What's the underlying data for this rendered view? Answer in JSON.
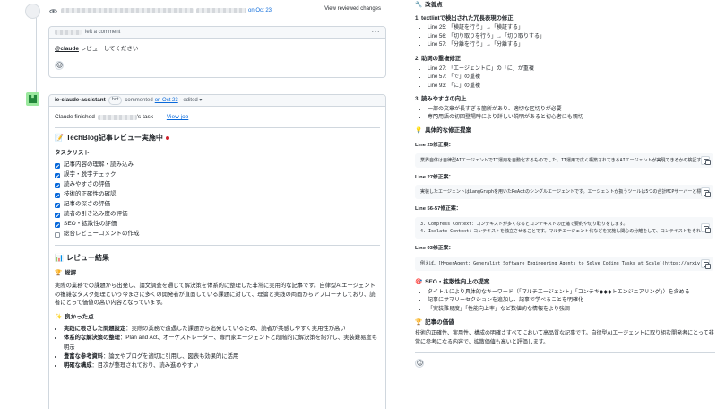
{
  "left": {
    "review_event": {
      "date_link": "on Oct 23",
      "view_reviewed": "View reviewed changes"
    },
    "comment1": {
      "header_action": "left a comment",
      "mention": "@claude",
      "body": " レビューしてください",
      "menu": "···"
    },
    "comment2": {
      "author": "ie-claude-assistant",
      "badge": "bot",
      "commented": "commented",
      "date_link": "on Oct 23",
      "edited": "· edited ▾",
      "menu": "···",
      "finished_prefix": "Claude finished",
      "finished_task": "'s task —— ",
      "view_job": "View job",
      "title": "TechBlog記事レビュー実施中",
      "title_icon": "memo-emoji",
      "task_heading": "タスクリスト",
      "tasks": [
        {
          "label": "記事内容の理解・読み込み",
          "done": true
        },
        {
          "label": "誤字・脱字チェック",
          "done": true
        },
        {
          "label": "読みやすさの評価",
          "done": true
        },
        {
          "label": "技術的正確性の確認",
          "done": true
        },
        {
          "label": "記事の深さの評価",
          "done": true
        },
        {
          "label": "読者の引き込み度の評価",
          "done": true
        },
        {
          "label": "SEO・拡散性の評価",
          "done": true
        },
        {
          "label": "総合レビューコメントの作成",
          "done": false
        }
      ],
      "review_title": "レビュー結果",
      "review_icon": "bar-chart-emoji",
      "overview_title": "総評",
      "overview_icon": "trophy-emoji",
      "overview": "実際の業務での課題から出発し、論文調査を通じて解決策を体系的に整理した非常に実用的な記事です。自律型AIエージェントの複雑なタスク処理という今まさに多くの開発者が直面している課題に対して、理論と実践の両面からアプローチしており、読者にとって価値の高い内容となっています。",
      "good_title": "良かった点",
      "good_icon": "sparkle-emoji",
      "good_points": [
        {
          "bold": "実践に根ざした問題設定",
          "text": "：実際の業務で遭遇した課題から出発しているため、読者が共感しやすく実用性が高い"
        },
        {
          "bold": "体系的な解決策の整理",
          "text": "：Plan and Act、オーケストレーター、専門家エージェントと段階的に解決策を紹介し、実装難易度も明示"
        },
        {
          "bold": "豊富な参考資料",
          "text": "：論文やブログを適切に引用し、図表も効果的に活用"
        },
        {
          "bold": "明確な構成",
          "text": "：目次が整理されており、読み進めやすい"
        }
      ]
    }
  },
  "right": {
    "improve_title": "改善点",
    "improve_icon": "wrench-emoji",
    "sec1": "1. textlintで検出された冗長表現の修正",
    "sec1_items": [
      "Line 25: 「検証を行う」→「検証する」",
      "Line 56: 「切り取りを行う」→「切り取りする」",
      "Line 57: 「分離を行う」→「分離する」"
    ],
    "sec2": "2. 助詞の重複修正",
    "sec2_items": [
      "Line 27: 「エージェントに」の「に」が重複",
      "Line 57: 「で」の重複",
      "Line 93: 「に」の重複"
    ],
    "sec3": "3. 読みやすさの向上",
    "sec3_items": [
      "一部の文章が長すぎる箇所があり、適切な区切りが必要",
      "専門用語の初回登場時により詳しい説明があると初心者にも親切"
    ],
    "concrete_title": "具体的な修正提案",
    "concrete_icon": "bulb-emoji",
    "fixes": [
      {
        "label": "Line 25修正案：",
        "code": [
          "業界自体は自律型AIエージェントでIT運用を自動化するものでした。IT運用で広く構築されてきるAIエージェントが実現できるかの検証する"
        ]
      },
      {
        "label": "Line 27修正案：",
        "code": [
          "実装したエージェントはLangGraphを用いたReActのシングルエージェントです。エージェントが扱うツールは5つの合計MCPサーバーと標"
        ]
      },
      {
        "label": "Line 56-57修正案：",
        "code": [
          "3. Compress Context：コンテキストが多くなるとコンテキストの圧縮で要約や切り取りをします。",
          "4. Isolate Context：コンテキストを独立させることです。マルチエージェント化などを実施し関心の分離をして、コンテキストをそれ..."
        ]
      },
      {
        "label": "Line 93修正案：",
        "code": [
          "例えば、[HyperAgent: Generalist Software Engineering Agents to Solve Coding Tasks at Scale](https://arxiv..."
        ]
      }
    ],
    "seo_title": "SEO・拡散性向上の提案",
    "seo_icon": "target-emoji",
    "seo_items": [
      "タイトルにより具体的なキーワード（「マルチエージェント」「コンテキ◆◆◆トエンジニアリング」）を含める",
      "記事にサマリーセクションを追加し、記事で学べることを明確化",
      "「実装難易度」「性能向上率」など数値的な情報をより強調"
    ],
    "value_title": "記事の価値",
    "value_icon": "trophy-emoji",
    "value_text": "技術的正確性、実用性、構成の明確さすべてにおいて高品質な記事です。自律型AIエージェントに取り組む開発者にとって非常に参考になる内容で、拡散価値も高いと評価します。"
  }
}
